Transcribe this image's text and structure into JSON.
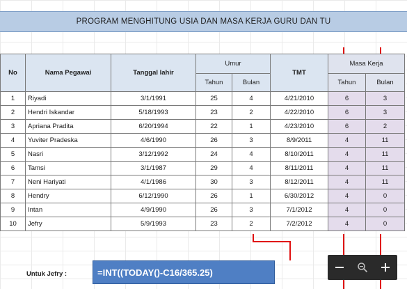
{
  "title": "PROGRAM MENGHITUNG USIA DAN MASA KERJA GURU DAN TU",
  "headers": {
    "no": "No",
    "nama": "Nama Pegawai",
    "tanggal_lahir": "Tanggal lahir",
    "umur": "Umur",
    "tmt": "TMT",
    "masa_kerja": "Masa Kerja",
    "tahun": "Tahun",
    "bulan": "Bulan"
  },
  "rows": [
    {
      "no": "1",
      "nama": "Riyadi",
      "tgl": "3/1/1991",
      "umur_th": "25",
      "umur_bl": "4",
      "tmt": "4/21/2010",
      "mk_th": "6",
      "mk_bl": "3"
    },
    {
      "no": "2",
      "nama": "Hendri Iskandar",
      "tgl": "5/18/1993",
      "umur_th": "23",
      "umur_bl": "2",
      "tmt": "4/22/2010",
      "mk_th": "6",
      "mk_bl": "3"
    },
    {
      "no": "3",
      "nama": "Apriana Pradita",
      "tgl": "6/20/1994",
      "umur_th": "22",
      "umur_bl": "1",
      "tmt": "4/23/2010",
      "mk_th": "6",
      "mk_bl": "2"
    },
    {
      "no": "4",
      "nama": "Yuviter Pradeska",
      "tgl": "4/6/1990",
      "umur_th": "26",
      "umur_bl": "3",
      "tmt": "8/9/2011",
      "mk_th": "4",
      "mk_bl": "11"
    },
    {
      "no": "5",
      "nama": "Nasri",
      "tgl": "3/12/1992",
      "umur_th": "24",
      "umur_bl": "4",
      "tmt": "8/10/2011",
      "mk_th": "4",
      "mk_bl": "11"
    },
    {
      "no": "6",
      "nama": "Tamsi",
      "tgl": "3/1/1987",
      "umur_th": "29",
      "umur_bl": "4",
      "tmt": "8/11/2011",
      "mk_th": "4",
      "mk_bl": "11"
    },
    {
      "no": "7",
      "nama": "Neni Hariyati",
      "tgl": "4/1/1986",
      "umur_th": "30",
      "umur_bl": "3",
      "tmt": "8/12/2011",
      "mk_th": "4",
      "mk_bl": "11"
    },
    {
      "no": "8",
      "nama": "Hendry",
      "tgl": "6/12/1990",
      "umur_th": "26",
      "umur_bl": "1",
      "tmt": "6/30/2012",
      "mk_th": "4",
      "mk_bl": "0"
    },
    {
      "no": "9",
      "nama": "Intan",
      "tgl": "4/9/1990",
      "umur_th": "26",
      "umur_bl": "3",
      "tmt": "7/1/2012",
      "mk_th": "4",
      "mk_bl": "0"
    },
    {
      "no": "10",
      "nama": "Jefry",
      "tgl": "5/9/1993",
      "umur_th": "23",
      "umur_bl": "2",
      "tmt": "7/2/2012",
      "mk_th": "4",
      "mk_bl": "0"
    }
  ],
  "footer": {
    "label": "Untuk Jefry :",
    "formula": "=INT((TODAY()-C16/365.25)"
  },
  "zoom_controls": {
    "zoom_out_icon": "minus-icon",
    "zoom_reset_icon": "magnifier-icon",
    "zoom_in_icon": "plus-icon"
  },
  "colors": {
    "title_fill": "#b8cce4",
    "header_fill": "#dbe5f1",
    "masa_kerja_fill": "#e4dcec",
    "formula_fill": "#4f7fc4",
    "annotation_red": "#e01010",
    "zoom_bar": "#2a2a2a"
  }
}
